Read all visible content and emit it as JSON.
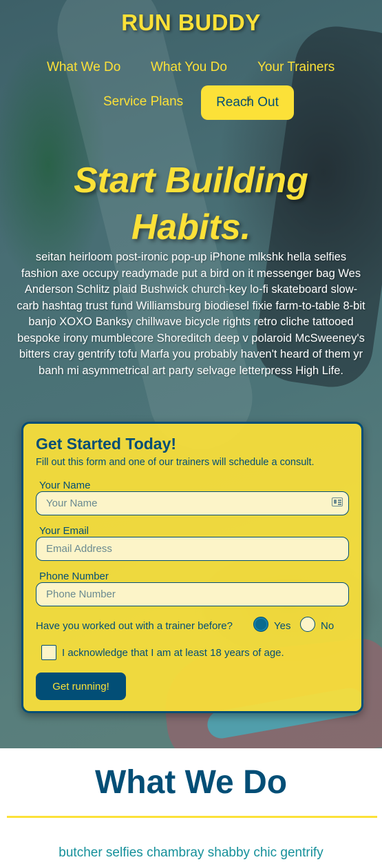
{
  "header": {
    "brand": "RUN BUDDY",
    "nav": [
      {
        "label": "What We Do"
      },
      {
        "label": "What You Do"
      },
      {
        "label": "Your Trainers"
      },
      {
        "label": "Service Plans"
      },
      {
        "label": "Reach Out"
      }
    ]
  },
  "hero": {
    "title_line1": "Start Building",
    "title_line2": "Habits.",
    "body": "seitan heirloom post-ironic pop-up iPhone mlkshk hella selfies fashion axe occupy readymade put a bird on it messenger bag Wes Anderson Schlitz plaid Bushwick church-key lo-fi skateboard slow-carb hashtag trust fund Williamsburg biodiesel fixie farm-to-table 8-bit banjo XOXO Banksy chillwave bicycle rights retro cliche tattooed bespoke irony mumblecore Shoreditch deep v polaroid McSweeney's bitters cray gentrify tofu Marfa you probably haven't heard of them yr banh mi asymmetrical art party selvage letterpress High Life."
  },
  "form": {
    "title": "Get Started Today!",
    "subtitle": "Fill out this form and one of our trainers will schedule a consult.",
    "name": {
      "label": "Your Name",
      "placeholder": "Your Name",
      "value": ""
    },
    "email": {
      "label": "Your Email",
      "placeholder": "Email Address",
      "value": ""
    },
    "phone": {
      "label": "Phone Number",
      "placeholder": "Phone Number",
      "value": ""
    },
    "question": "Have you worked out with a trainer before?",
    "options": [
      {
        "label": "Yes",
        "checked": true
      },
      {
        "label": "No",
        "checked": false
      }
    ],
    "acknowledge": {
      "label": "I acknowledge that I am at least 18 years of age.",
      "checked": false
    },
    "submit_label": "Get running!"
  },
  "what_we_do": {
    "title": "What We Do",
    "subtitle": "butcher selfies chambray shabby chic gentrify"
  },
  "colors": {
    "accent_yellow": "#fce138",
    "brand_blue": "#024e76",
    "teal_text": "#15909a"
  }
}
